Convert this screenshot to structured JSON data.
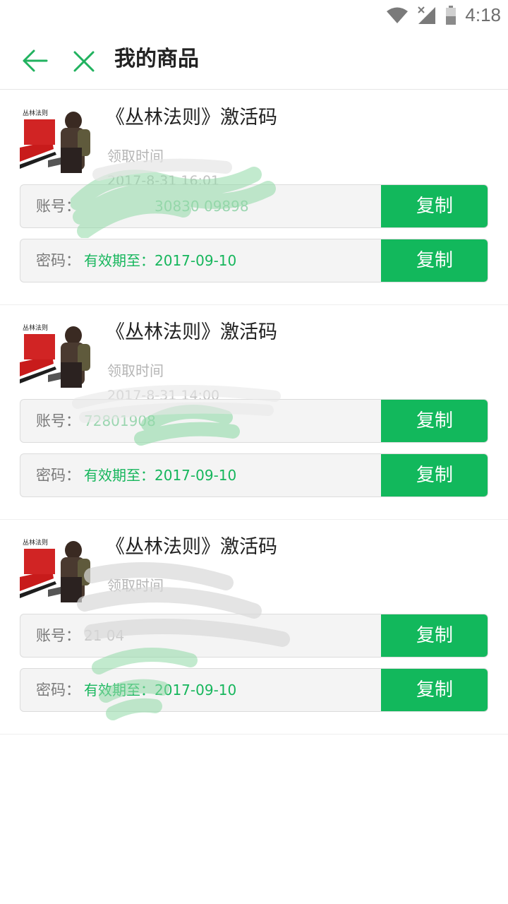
{
  "status_bar": {
    "time": "4:18",
    "icons": [
      "wifi-icon",
      "signal-icon",
      "battery-icon"
    ]
  },
  "header": {
    "title": "我的商品",
    "back_icon": "arrow-left-icon",
    "close_icon": "close-icon"
  },
  "colors": {
    "accent": "#12b85c",
    "title": "#222222",
    "muted": "#b5b5b5",
    "row_bg": "#f4f4f4"
  },
  "items": [
    {
      "title": "《丛林法则》激活码",
      "claim_label": "领取时间",
      "claim_time": "2017-8-31 16:01",
      "account_label": "账号：",
      "account_value": "30830 09898",
      "password_label": "密码：",
      "password_value": "有效期至：2017-09-10",
      "copy_label": "复制",
      "thumb_caption": "丛林法则"
    },
    {
      "title": "《丛林法则》激活码",
      "claim_label": "领取时间",
      "claim_time": "2017-8-31 14:00",
      "account_label": "账号：",
      "account_value": "72801908",
      "password_label": "密码：",
      "password_value": "有效期至：2017-09-10",
      "copy_label": "复制",
      "thumb_caption": "丛林法则"
    },
    {
      "title": "《丛林法则》激活码",
      "claim_label": "领取时间",
      "claim_time": "",
      "account_label": "账号：",
      "account_value": "21 04",
      "password_label": "密码：",
      "password_value": "有效期至：2017-09-10",
      "copy_label": "复制",
      "thumb_caption": "丛林法则"
    }
  ]
}
